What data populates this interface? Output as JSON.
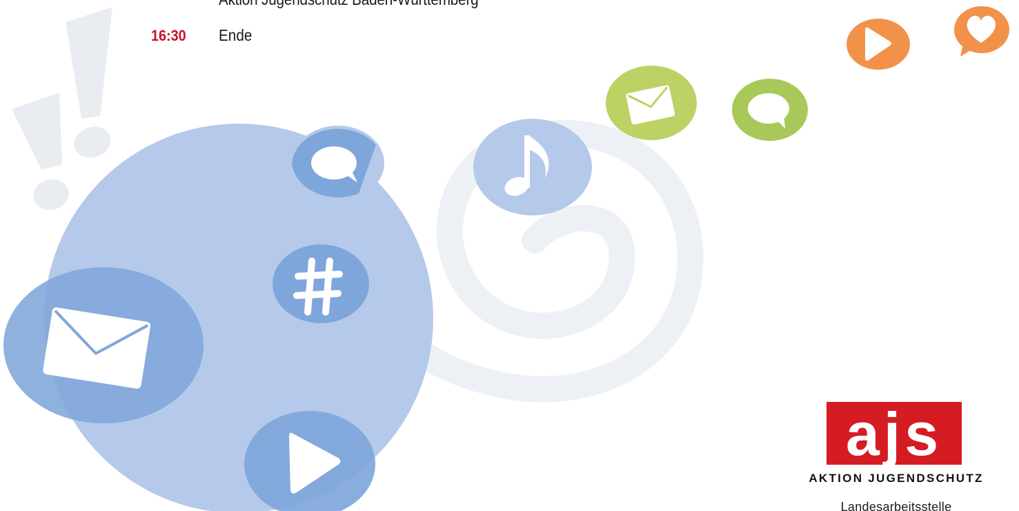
{
  "header": {
    "cut_line": "Aktion Jugendschutz Baden-Württemberg"
  },
  "agenda": [
    {
      "time": "16:30",
      "title": "Ende"
    }
  ],
  "logo": {
    "letters": "ajs",
    "name": "AKTION JUGENDSCHUTZ",
    "subtitle": "Landesarbeitsstelle"
  },
  "icons": [
    "exclamation-marks-icon",
    "swirl-icon",
    "envelope-icon",
    "chat-bubble-icon",
    "hashtag-icon",
    "play-icon",
    "music-note-icon",
    "heart-chat-icon"
  ],
  "colors": {
    "accent_red": "#c8102e",
    "logo_red": "#d51c23",
    "blue_light": "#b5c9ea",
    "blue_mid": "#7fa6da",
    "green": "#a8c85a",
    "green_light": "#bdd264",
    "orange": "#f2924a",
    "swirl": "#edf1f6",
    "exclamation": "#e9edf2"
  }
}
